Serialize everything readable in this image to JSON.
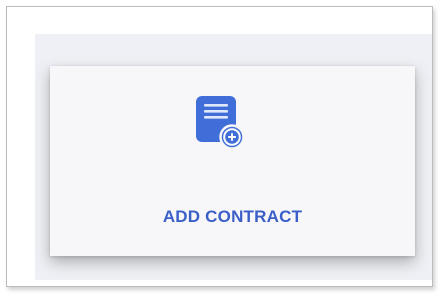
{
  "card": {
    "label": "ADD CONTRACT",
    "icon": "add-document-icon"
  },
  "colors": {
    "accent": "#3a5fc8",
    "icon_fill": "#3f6ed8",
    "card_background": "#f7f7f9",
    "panel_background": "#eef0f5"
  }
}
